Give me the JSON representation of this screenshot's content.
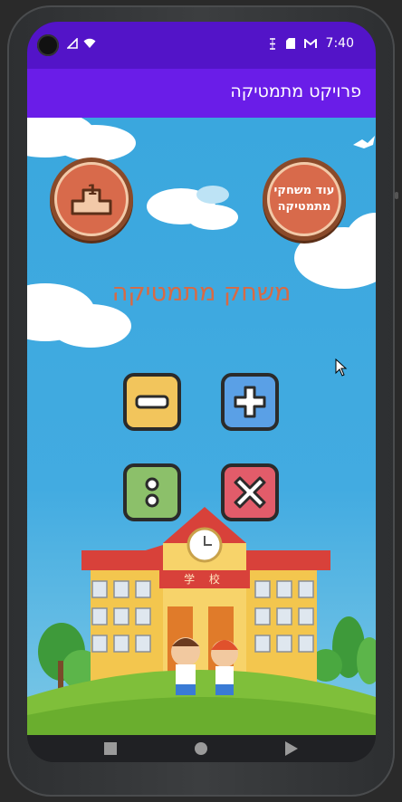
{
  "status": {
    "time": "7:40"
  },
  "appbar": {
    "title": "פרויקט מתמטיקה"
  },
  "buttons": {
    "leaderboard_number": "1",
    "more_games_label": "עוד משחקי מתמטיקה"
  },
  "game": {
    "title": "משחק מתמטיקה"
  },
  "operations": [
    {
      "name": "minus",
      "color": "#f2c55c"
    },
    {
      "name": "plus",
      "color": "#5aa0e6"
    },
    {
      "name": "divide",
      "color": "#8cc06a"
    },
    {
      "name": "multiply",
      "color": "#e25c6a"
    }
  ],
  "school": {
    "sign": "学 校"
  },
  "colors": {
    "status_bar": "#5314c8",
    "app_bar": "#6a1de8",
    "sky": "#3aa7de",
    "title": "#d86a44"
  }
}
